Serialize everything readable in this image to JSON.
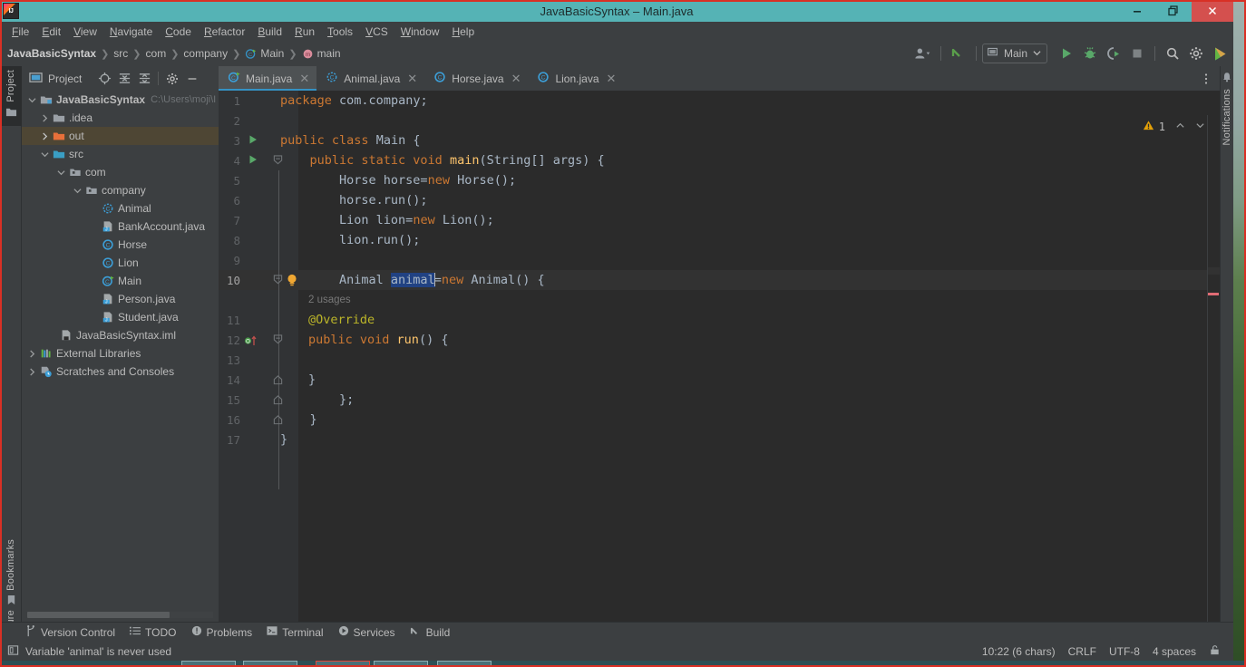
{
  "window": {
    "title": "JavaBasicSyntax – Main.java",
    "logo_icon": "intellij-idea-logo",
    "minimize_icon": "minimize-icon",
    "maximize_icon": "restore-icon",
    "close_icon": "close-icon",
    "titlebar_color": "#55b3b5",
    "accent_color": "#3592c4"
  },
  "menubar": {
    "items": [
      {
        "label": "File",
        "mnemonic": "F"
      },
      {
        "label": "Edit",
        "mnemonic": "E"
      },
      {
        "label": "View",
        "mnemonic": "V"
      },
      {
        "label": "Navigate",
        "mnemonic": "N"
      },
      {
        "label": "Code",
        "mnemonic": "C"
      },
      {
        "label": "Refactor",
        "mnemonic": "R"
      },
      {
        "label": "Build",
        "mnemonic": "B"
      },
      {
        "label": "Run",
        "mnemonic": "R"
      },
      {
        "label": "Tools",
        "mnemonic": "T"
      },
      {
        "label": "VCS",
        "mnemonic": "V"
      },
      {
        "label": "Window",
        "mnemonic": "W"
      },
      {
        "label": "Help",
        "mnemonic": "H"
      }
    ]
  },
  "breadcrumb": {
    "items": [
      {
        "label": "JavaBasicSyntax",
        "icon": null,
        "bold": true
      },
      {
        "label": "src",
        "icon": null,
        "bold": false
      },
      {
        "label": "com",
        "icon": null,
        "bold": false
      },
      {
        "label": "company",
        "icon": null,
        "bold": false
      },
      {
        "label": "Main",
        "icon": "java-class-icon",
        "bold": false
      },
      {
        "label": "main",
        "icon": "method-icon",
        "bold": false
      }
    ],
    "separator": "›"
  },
  "toolbar": {
    "account_icon": "user-account-icon",
    "update_icon": "update-project-icon",
    "run_config": {
      "label": "Main",
      "icon": "run-config-icon",
      "chevron": "chevron-down-icon"
    },
    "run_icon": "run-icon",
    "debug_icon": "debug-icon",
    "coverage_icon": "run-with-coverage-icon",
    "stop_icon": "stop-icon",
    "search_icon": "search-everywhere-icon",
    "settings_icon": "settings-gear-icon",
    "ide_icon": "ide-feature-icon"
  },
  "left_strip": {
    "items": [
      {
        "label": "Project",
        "icon": "project-icon",
        "active": true
      },
      {
        "label": "Bookmarks",
        "icon": "bookmarks-icon",
        "active": false
      },
      {
        "label": "Structure",
        "icon": "structure-icon",
        "active": false
      }
    ]
  },
  "right_strip": {
    "items": [
      {
        "label": "Notifications",
        "icon": "notifications-icon"
      }
    ]
  },
  "project_panel": {
    "title": "Project",
    "title_icon": "project-view-icon",
    "toolbar_icons": [
      "locate-icon",
      "expand-all-icon",
      "collapse-all-icon",
      "settings-gear-icon",
      "hide-icon"
    ],
    "tree": [
      {
        "indent": 0,
        "arrow": "down",
        "icon": "module-icon",
        "label": "JavaBasicSyntax",
        "bold": true,
        "path": "C:\\Users\\moji\\I",
        "selected": false
      },
      {
        "indent": 1,
        "arrow": "right",
        "icon": "folder-icon",
        "label": ".idea",
        "bold": false,
        "path": "",
        "selected": false
      },
      {
        "indent": 1,
        "arrow": "right",
        "icon": "folder-out-icon",
        "label": "out",
        "bold": false,
        "path": "",
        "selected": true
      },
      {
        "indent": 1,
        "arrow": "down",
        "icon": "folder-src-icon",
        "label": "src",
        "bold": false,
        "path": "",
        "selected": false
      },
      {
        "indent": 2,
        "arrow": "down",
        "icon": "package-icon",
        "label": "com",
        "bold": false,
        "path": "",
        "selected": false
      },
      {
        "indent": 3,
        "arrow": "down",
        "icon": "package-icon",
        "label": "company",
        "bold": false,
        "path": "",
        "selected": false
      },
      {
        "indent": 4,
        "arrow": "none",
        "icon": "interface-icon",
        "label": "Animal",
        "bold": false,
        "path": "",
        "selected": false
      },
      {
        "indent": 4,
        "arrow": "none",
        "icon": "java-file-icon",
        "label": "BankAccount.java",
        "bold": false,
        "path": "",
        "selected": false
      },
      {
        "indent": 4,
        "arrow": "none",
        "icon": "class-icon",
        "label": "Horse",
        "bold": false,
        "path": "",
        "selected": false
      },
      {
        "indent": 4,
        "arrow": "none",
        "icon": "class-icon",
        "label": "Lion",
        "bold": false,
        "path": "",
        "selected": false
      },
      {
        "indent": 4,
        "arrow": "none",
        "icon": "runnable-class-icon",
        "label": "Main",
        "bold": false,
        "path": "",
        "selected": false
      },
      {
        "indent": 4,
        "arrow": "none",
        "icon": "java-file-icon",
        "label": "Person.java",
        "bold": false,
        "path": "",
        "selected": false
      },
      {
        "indent": 4,
        "arrow": "none",
        "icon": "java-file-icon",
        "label": "Student.java",
        "bold": false,
        "path": "",
        "selected": false
      },
      {
        "indent": 2,
        "arrow": "none",
        "icon": "iml-file-icon",
        "label": "JavaBasicSyntax.iml",
        "bold": false,
        "path": "",
        "selected": false
      },
      {
        "indent": 0,
        "arrow": "right",
        "icon": "libraries-icon",
        "label": "External Libraries",
        "bold": false,
        "path": "",
        "selected": false
      },
      {
        "indent": 0,
        "arrow": "right",
        "icon": "scratches-icon",
        "label": "Scratches and Consoles",
        "bold": false,
        "path": "",
        "selected": false
      }
    ]
  },
  "editor": {
    "tabs": [
      {
        "label": "Main.java",
        "icon": "runnable-class-icon",
        "active": true,
        "close_icon": "close-icon"
      },
      {
        "label": "Animal.java",
        "icon": "interface-icon",
        "active": false,
        "close_icon": "close-icon"
      },
      {
        "label": "Horse.java",
        "icon": "class-icon",
        "active": false,
        "close_icon": "close-icon"
      },
      {
        "label": "Lion.java",
        "icon": "class-icon",
        "active": false,
        "close_icon": "close-icon"
      }
    ],
    "tabs_more_icon": "more-options-icon",
    "inspection": {
      "warning_icon": "warning-triangle-icon",
      "count": "1",
      "up_icon": "chevron-up-icon",
      "down_icon": "chevron-down-icon"
    },
    "lines": [
      {
        "num": "1",
        "gutter": null,
        "fold": null,
        "text": "package com.company;"
      },
      {
        "num": "2",
        "gutter": null,
        "fold": null,
        "text": ""
      },
      {
        "num": "3",
        "gutter": "run-gutter-icon",
        "fold": null,
        "text": "public class Main {"
      },
      {
        "num": "4",
        "gutter": "run-gutter-icon",
        "fold": "open",
        "text": "    public static void main(String[] args) {"
      },
      {
        "num": "5",
        "gutter": null,
        "fold": null,
        "text": "        Horse horse=new Horse();"
      },
      {
        "num": "6",
        "gutter": null,
        "fold": null,
        "text": "        horse.run();"
      },
      {
        "num": "7",
        "gutter": null,
        "fold": null,
        "text": "        Lion lion=new Lion();"
      },
      {
        "num": "8",
        "gutter": null,
        "fold": null,
        "text": "        lion.run();"
      },
      {
        "num": "9",
        "gutter": null,
        "fold": null,
        "text": ""
      },
      {
        "num": "10",
        "gutter": "intention-bulb-icon",
        "fold": "open",
        "text": "        Animal animal=new Animal() {"
      },
      {
        "num": "",
        "gutter": null,
        "fold": null,
        "text": "            2 usages"
      },
      {
        "num": "11",
        "gutter": null,
        "fold": null,
        "text": "            @Override"
      },
      {
        "num": "12",
        "gutter": "implements-icon",
        "fold": "open",
        "text": "            public void run() {"
      },
      {
        "num": "13",
        "gutter": null,
        "fold": null,
        "text": ""
      },
      {
        "num": "14",
        "gutter": null,
        "fold": "close",
        "text": "            }"
      },
      {
        "num": "15",
        "gutter": null,
        "fold": "close",
        "text": "        };"
      },
      {
        "num": "16",
        "gutter": null,
        "fold": "close",
        "text": "    }"
      },
      {
        "num": "17",
        "gutter": null,
        "fold": null,
        "text": "}"
      }
    ],
    "selected_token": "animal",
    "inline_hint": "2 usages"
  },
  "bottom_tools": {
    "items": [
      {
        "label": "Version Control",
        "icon": "version-control-icon"
      },
      {
        "label": "TODO",
        "icon": "todo-icon"
      },
      {
        "label": "Problems",
        "icon": "problems-icon"
      },
      {
        "label": "Terminal",
        "icon": "terminal-icon"
      },
      {
        "label": "Services",
        "icon": "services-icon"
      },
      {
        "label": "Build",
        "icon": "build-icon"
      }
    ]
  },
  "statusbar": {
    "message": "Variable 'animal' is never used",
    "message_icon": "event-log-icon",
    "caret_position": "10:22 (6 chars)",
    "line_separator": "CRLF",
    "encoding": "UTF-8",
    "indent": "4 spaces",
    "lock_icon": "read-write-lock-icon"
  }
}
